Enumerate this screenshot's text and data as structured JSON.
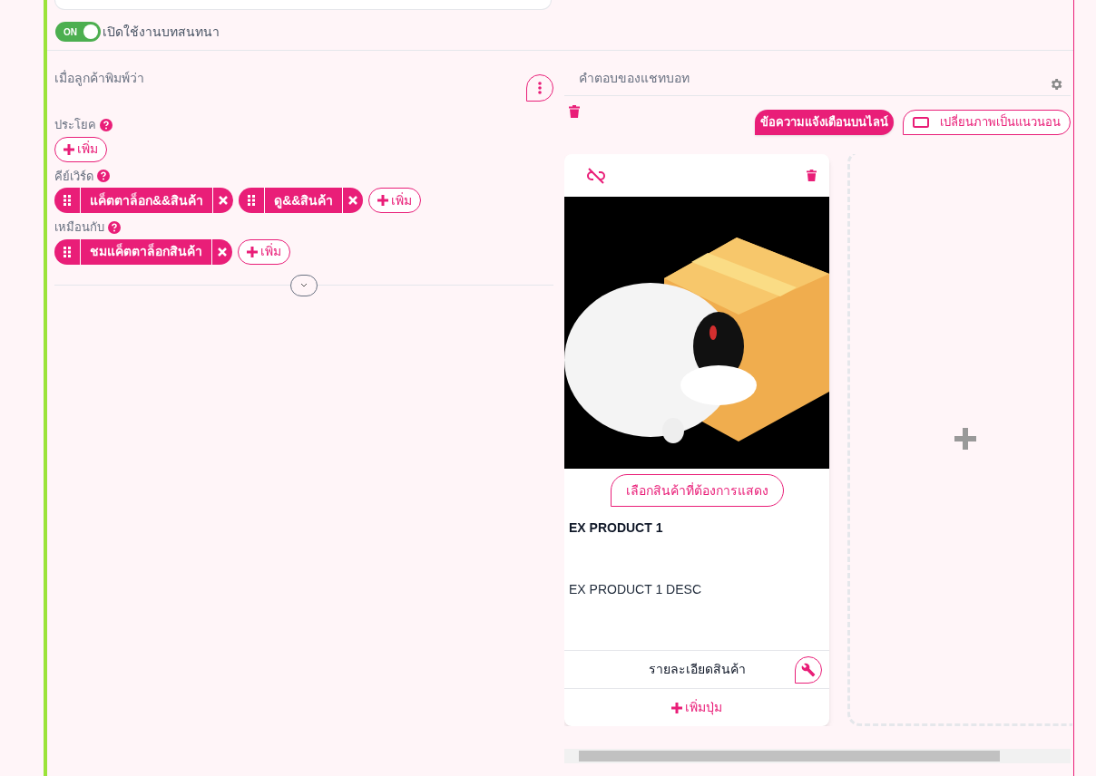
{
  "toggle": {
    "label": "ON",
    "on": true,
    "text": "เปิดใช้งานบทสนทนา"
  },
  "trigger": {
    "title": "เมื่อลูกค้าพิมพ์ว่า",
    "groups": [
      {
        "label": "ประโยค",
        "add": "เพิ่ม"
      },
      {
        "label": "คีย์เวิร์ด",
        "tags": [
          "แค็ตตาล็อก&&สินค้า",
          "ดู&&สินค้า"
        ],
        "add": "เพิ่ม"
      },
      {
        "label": "เหมือนกับ",
        "tags": [
          "ชมแค็ตตาล็อกสินค้า"
        ],
        "add": "เพิ่ม"
      }
    ]
  },
  "response": {
    "title": "คำตอบของแชทบอท",
    "buttons": [
      {
        "kind": "filled",
        "label": "ข้อความแจ้งเตือนบนไลน์"
      },
      {
        "kind": "outline",
        "label": "เปลี่ยนภาพเป็นแนวนอน"
      }
    ],
    "card": {
      "select": "เลือกสินค้าที่ต้องการแสดง",
      "title": "EX PRODUCT 1",
      "description": "EX PRODUCT 1 DESC",
      "action": "รายละเอียดสินค้า",
      "add_button": "เพิ่มปุ่ม"
    }
  }
}
